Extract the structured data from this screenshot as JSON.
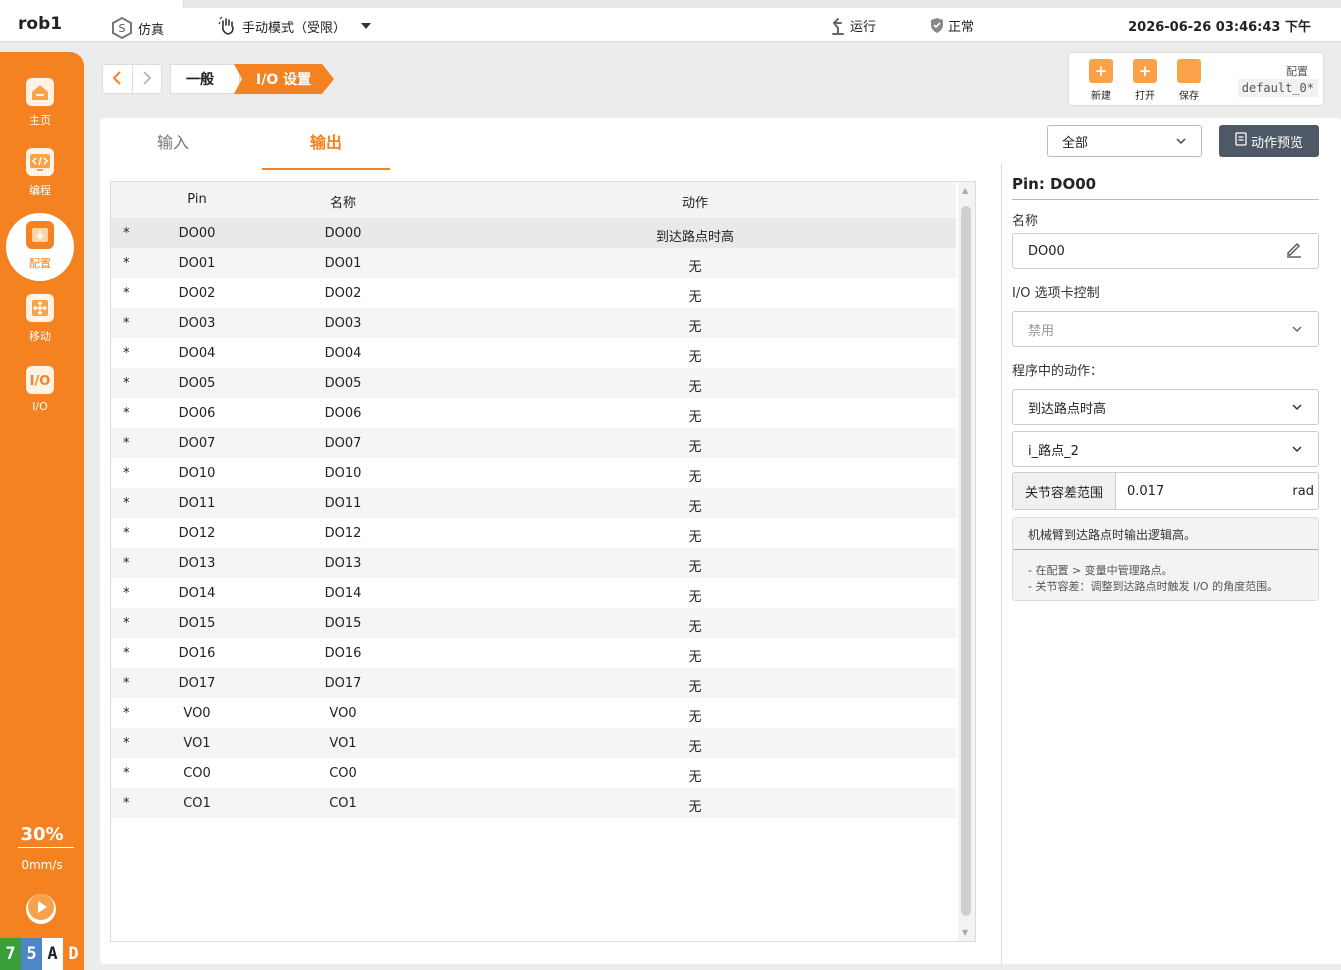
{
  "topbar": {
    "robot_name": "rob1",
    "sim_label": "仿真",
    "mode_label": "手动模式（受限）",
    "run_label": "运行",
    "status_label": "正常",
    "datetime": "2026-06-26 03:46:43 下午"
  },
  "sidebar": {
    "items": [
      {
        "label": "主页",
        "icon": "home-icon"
      },
      {
        "label": "编程",
        "icon": "code-icon"
      },
      {
        "label": "配置",
        "icon": "config-icon"
      },
      {
        "label": "移动",
        "icon": "move-icon"
      },
      {
        "label": "I/O",
        "icon": "io-icon"
      }
    ],
    "speed_percent": "30%",
    "speed_mms": "0mm/s",
    "logo": [
      "7",
      "5",
      "A",
      "D"
    ],
    "colors": {
      "accent": "#f58220",
      "logo_7": "#3a9e3a",
      "logo_5": "#4f86c6",
      "logo_A": "#ffffff",
      "logo_D": "#f58220"
    }
  },
  "breadcrumb": {
    "items": [
      "一般",
      "I/O 设置"
    ]
  },
  "config": {
    "new_label": "新建",
    "open_label": "打开",
    "save_label": "保存",
    "section_label": "配置",
    "name": "default_0*"
  },
  "tabs": {
    "input": "输入",
    "output": "输出"
  },
  "filter": {
    "value": "全部"
  },
  "preview_button": "动作预览",
  "table": {
    "headers": {
      "pin": "Pin",
      "name": "名称",
      "action": "动作"
    },
    "rows": [
      {
        "star": "*",
        "pin": "DO00",
        "name": "DO00",
        "action": "到达路点时高"
      },
      {
        "star": "*",
        "pin": "DO01",
        "name": "DO01",
        "action": "无"
      },
      {
        "star": "*",
        "pin": "DO02",
        "name": "DO02",
        "action": "无"
      },
      {
        "star": "*",
        "pin": "DO03",
        "name": "DO03",
        "action": "无"
      },
      {
        "star": "*",
        "pin": "DO04",
        "name": "DO04",
        "action": "无"
      },
      {
        "star": "*",
        "pin": "DO05",
        "name": "DO05",
        "action": "无"
      },
      {
        "star": "*",
        "pin": "DO06",
        "name": "DO06",
        "action": "无"
      },
      {
        "star": "*",
        "pin": "DO07",
        "name": "DO07",
        "action": "无"
      },
      {
        "star": "*",
        "pin": "DO10",
        "name": "DO10",
        "action": "无"
      },
      {
        "star": "*",
        "pin": "DO11",
        "name": "DO11",
        "action": "无"
      },
      {
        "star": "*",
        "pin": "DO12",
        "name": "DO12",
        "action": "无"
      },
      {
        "star": "*",
        "pin": "DO13",
        "name": "DO13",
        "action": "无"
      },
      {
        "star": "*",
        "pin": "DO14",
        "name": "DO14",
        "action": "无"
      },
      {
        "star": "*",
        "pin": "DO15",
        "name": "DO15",
        "action": "无"
      },
      {
        "star": "*",
        "pin": "DO16",
        "name": "DO16",
        "action": "无"
      },
      {
        "star": "*",
        "pin": "DO17",
        "name": "DO17",
        "action": "无"
      },
      {
        "star": "*",
        "pin": "VO0",
        "name": "VO0",
        "action": "无"
      },
      {
        "star": "*",
        "pin": "VO1",
        "name": "VO1",
        "action": "无"
      },
      {
        "star": "*",
        "pin": "CO0",
        "name": "CO0",
        "action": "无"
      },
      {
        "star": "*",
        "pin": "CO1",
        "name": "CO1",
        "action": "无"
      }
    ]
  },
  "detail": {
    "pin_title": "Pin: DO00",
    "name_label": "名称",
    "name_value": "DO00",
    "io_tab_label": "I/O 选项卡控制",
    "io_tab_value": "禁用",
    "action_label": "程序中的动作：",
    "action_value": "到达路点时高",
    "waypoint_value": "i_路点_2",
    "tolerance_label": "关节容差范围",
    "tolerance_value": "0.017",
    "tolerance_unit": "rad",
    "info_header": "机械臂到达路点时输出逻辑高。",
    "info_line1": "- 在配置 > 变量中管理路点。",
    "info_line2": "- 关节容差：调整到达路点时触发 I/O 的角度范围。"
  }
}
